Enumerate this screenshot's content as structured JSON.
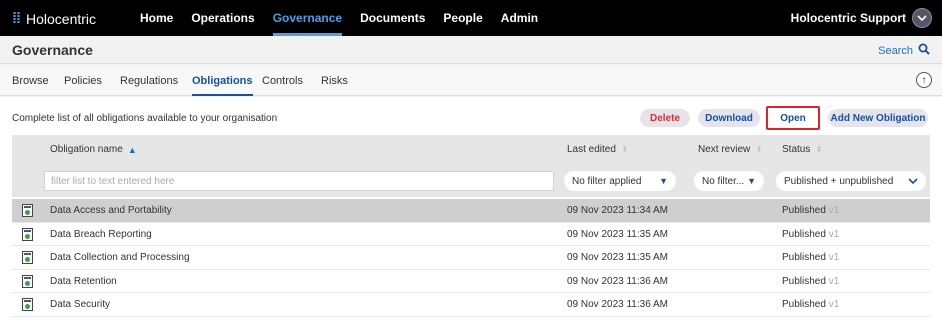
{
  "app": {
    "logo_text": "Holocentric"
  },
  "nav": [
    {
      "label": "Home"
    },
    {
      "label": "Operations"
    },
    {
      "label": "Governance",
      "active": true
    },
    {
      "label": "Documents"
    },
    {
      "label": "People"
    },
    {
      "label": "Admin"
    }
  ],
  "user": {
    "name": "Holocentric Support"
  },
  "page": {
    "title": "Governance",
    "search_label": "Search"
  },
  "tabs": [
    {
      "label": "Browse"
    },
    {
      "label": "Policies"
    },
    {
      "label": "Regulations"
    },
    {
      "label": "Obligations",
      "active": true
    },
    {
      "label": "Controls"
    },
    {
      "label": "Risks"
    }
  ],
  "main": {
    "description": "Complete list of all obligations available to your organisation",
    "buttons": {
      "delete": "Delete",
      "download": "Download",
      "open": "Open",
      "add_new": "Add New Obligation"
    }
  },
  "table": {
    "columns": [
      "Obligation name",
      "Last edited",
      "Next review",
      "Status"
    ],
    "filters": {
      "name_placeholder": "filter list to text entered here",
      "last_edited": "No filter applied",
      "next_review": "No filter...",
      "status": "Published + unpublished"
    },
    "rows": [
      {
        "name": "Data Access and Portability",
        "last_edited": "09 Nov 2023 11:34 AM",
        "next_review": "",
        "status": "Published",
        "version": "v1",
        "selected": true
      },
      {
        "name": "Data Breach Reporting",
        "last_edited": "09 Nov 2023 11:35 AM",
        "next_review": "",
        "status": "Published",
        "version": "v1"
      },
      {
        "name": "Data Collection and Processing",
        "last_edited": "09 Nov 2023 11:35 AM",
        "next_review": "",
        "status": "Published",
        "version": "v1"
      },
      {
        "name": "Data Retention",
        "last_edited": "09 Nov 2023 11:36 AM",
        "next_review": "",
        "status": "Published",
        "version": "v1"
      },
      {
        "name": "Data Security",
        "last_edited": "09 Nov 2023 11:36 AM",
        "next_review": "",
        "status": "Published",
        "version": "v1"
      }
    ]
  },
  "colors": {
    "accent": "#4f9fe8",
    "link": "#1a4fa0",
    "danger": "#d0303a",
    "highlight_border": "#e0202a"
  },
  "icons": {
    "search": "search-icon",
    "upload": "upload-icon",
    "row": "obligation-icon",
    "user_menu": "chevron-down-icon"
  }
}
